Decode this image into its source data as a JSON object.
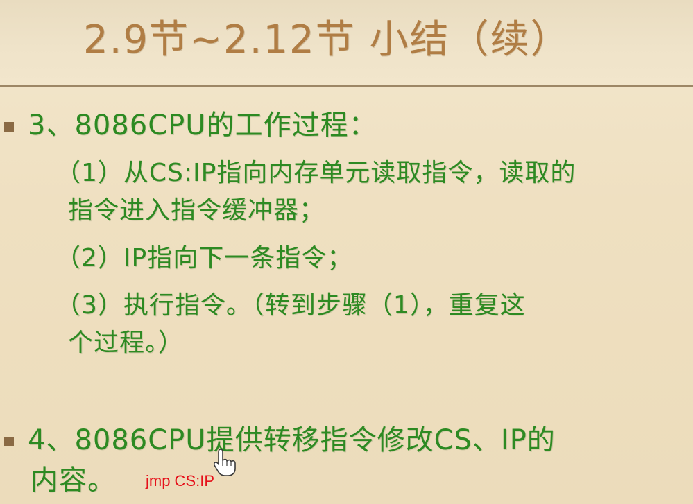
{
  "slide": {
    "title_fragment": "",
    "title": "2.9节~2.12节 小结（续）",
    "section3": {
      "heading": "3、8086CPU的工作过程：",
      "step1_line1": "（1）从CS:IP指向内存单元读取指令，读取的",
      "step1_line2": "指令进入指令缓冲器；",
      "step2": "（2）IP指向下一条指令；",
      "step3_line1": "（3）执行指令。（转到步骤（1），重复这",
      "step3_line2": "个过程。）"
    },
    "section4": {
      "line1": "4、8086CPU提供转移指令修改CS、IP的",
      "line2": "内容。"
    },
    "annotation": "jmp CS:IP"
  },
  "colors": {
    "background": "#f1e3c6",
    "title": "#b07d44",
    "body_text": "#2d8a22",
    "bullet": "#8a6a44",
    "annotation": "#e5101a"
  },
  "icons": {
    "bullet": "square-bullet-icon",
    "cursor": "hand-pointer-icon"
  }
}
